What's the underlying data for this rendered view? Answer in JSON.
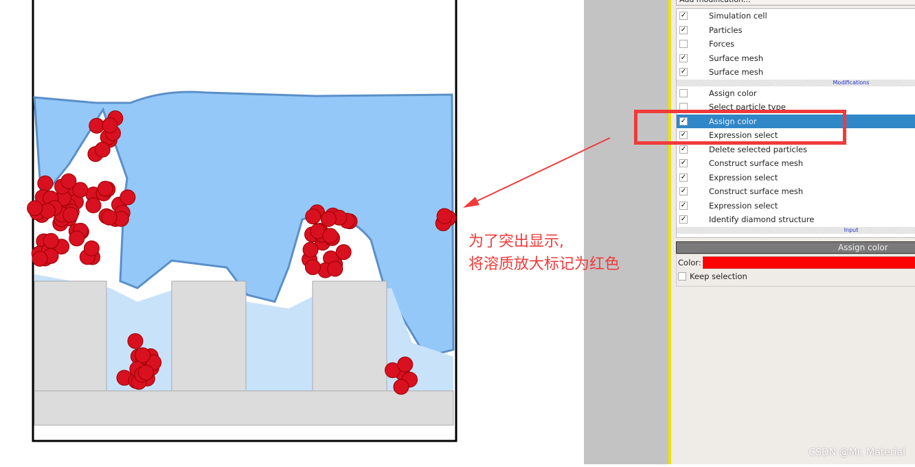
{
  "pipeline": {
    "add_modification": "Add modification...",
    "items": [
      {
        "label": "Simulation cell",
        "checked": true
      },
      {
        "label": "Particles",
        "checked": true
      },
      {
        "label": "Forces",
        "checked": false
      },
      {
        "label": "Surface mesh",
        "checked": true
      },
      {
        "label": "Surface mesh",
        "checked": true
      }
    ],
    "modifications_header": "Modifications",
    "modifications": [
      {
        "label": "Assign color",
        "checked": false
      },
      {
        "label": "Select particle type",
        "checked": false
      },
      {
        "label": "Assign color",
        "checked": true,
        "selected": true
      },
      {
        "label": "Expression select",
        "checked": true
      },
      {
        "label": "Delete selected particles",
        "checked": true
      },
      {
        "label": "Construct surface mesh",
        "checked": true
      },
      {
        "label": "Expression select",
        "checked": true
      },
      {
        "label": "Construct surface mesh",
        "checked": true
      },
      {
        "label": "Expression select",
        "checked": true
      },
      {
        "label": "Identify diamond structure",
        "checked": true
      }
    ],
    "input_header": "Input"
  },
  "properties": {
    "title": "Assign color",
    "color_label": "Color:",
    "color_value": "#ff0000",
    "keep_selection_label": "Keep selection",
    "keep_selection": false
  },
  "annotation": {
    "line1": "为了突出显示,",
    "line2": "将溶质放大标记为红色",
    "color": "#f03a3a"
  },
  "watermark": "CSDN @Mr. Material",
  "colors": {
    "solvent": "#94c8f8",
    "solute": "#d81020",
    "substrate": "#dcdcdc",
    "selection": "#3087c8"
  }
}
